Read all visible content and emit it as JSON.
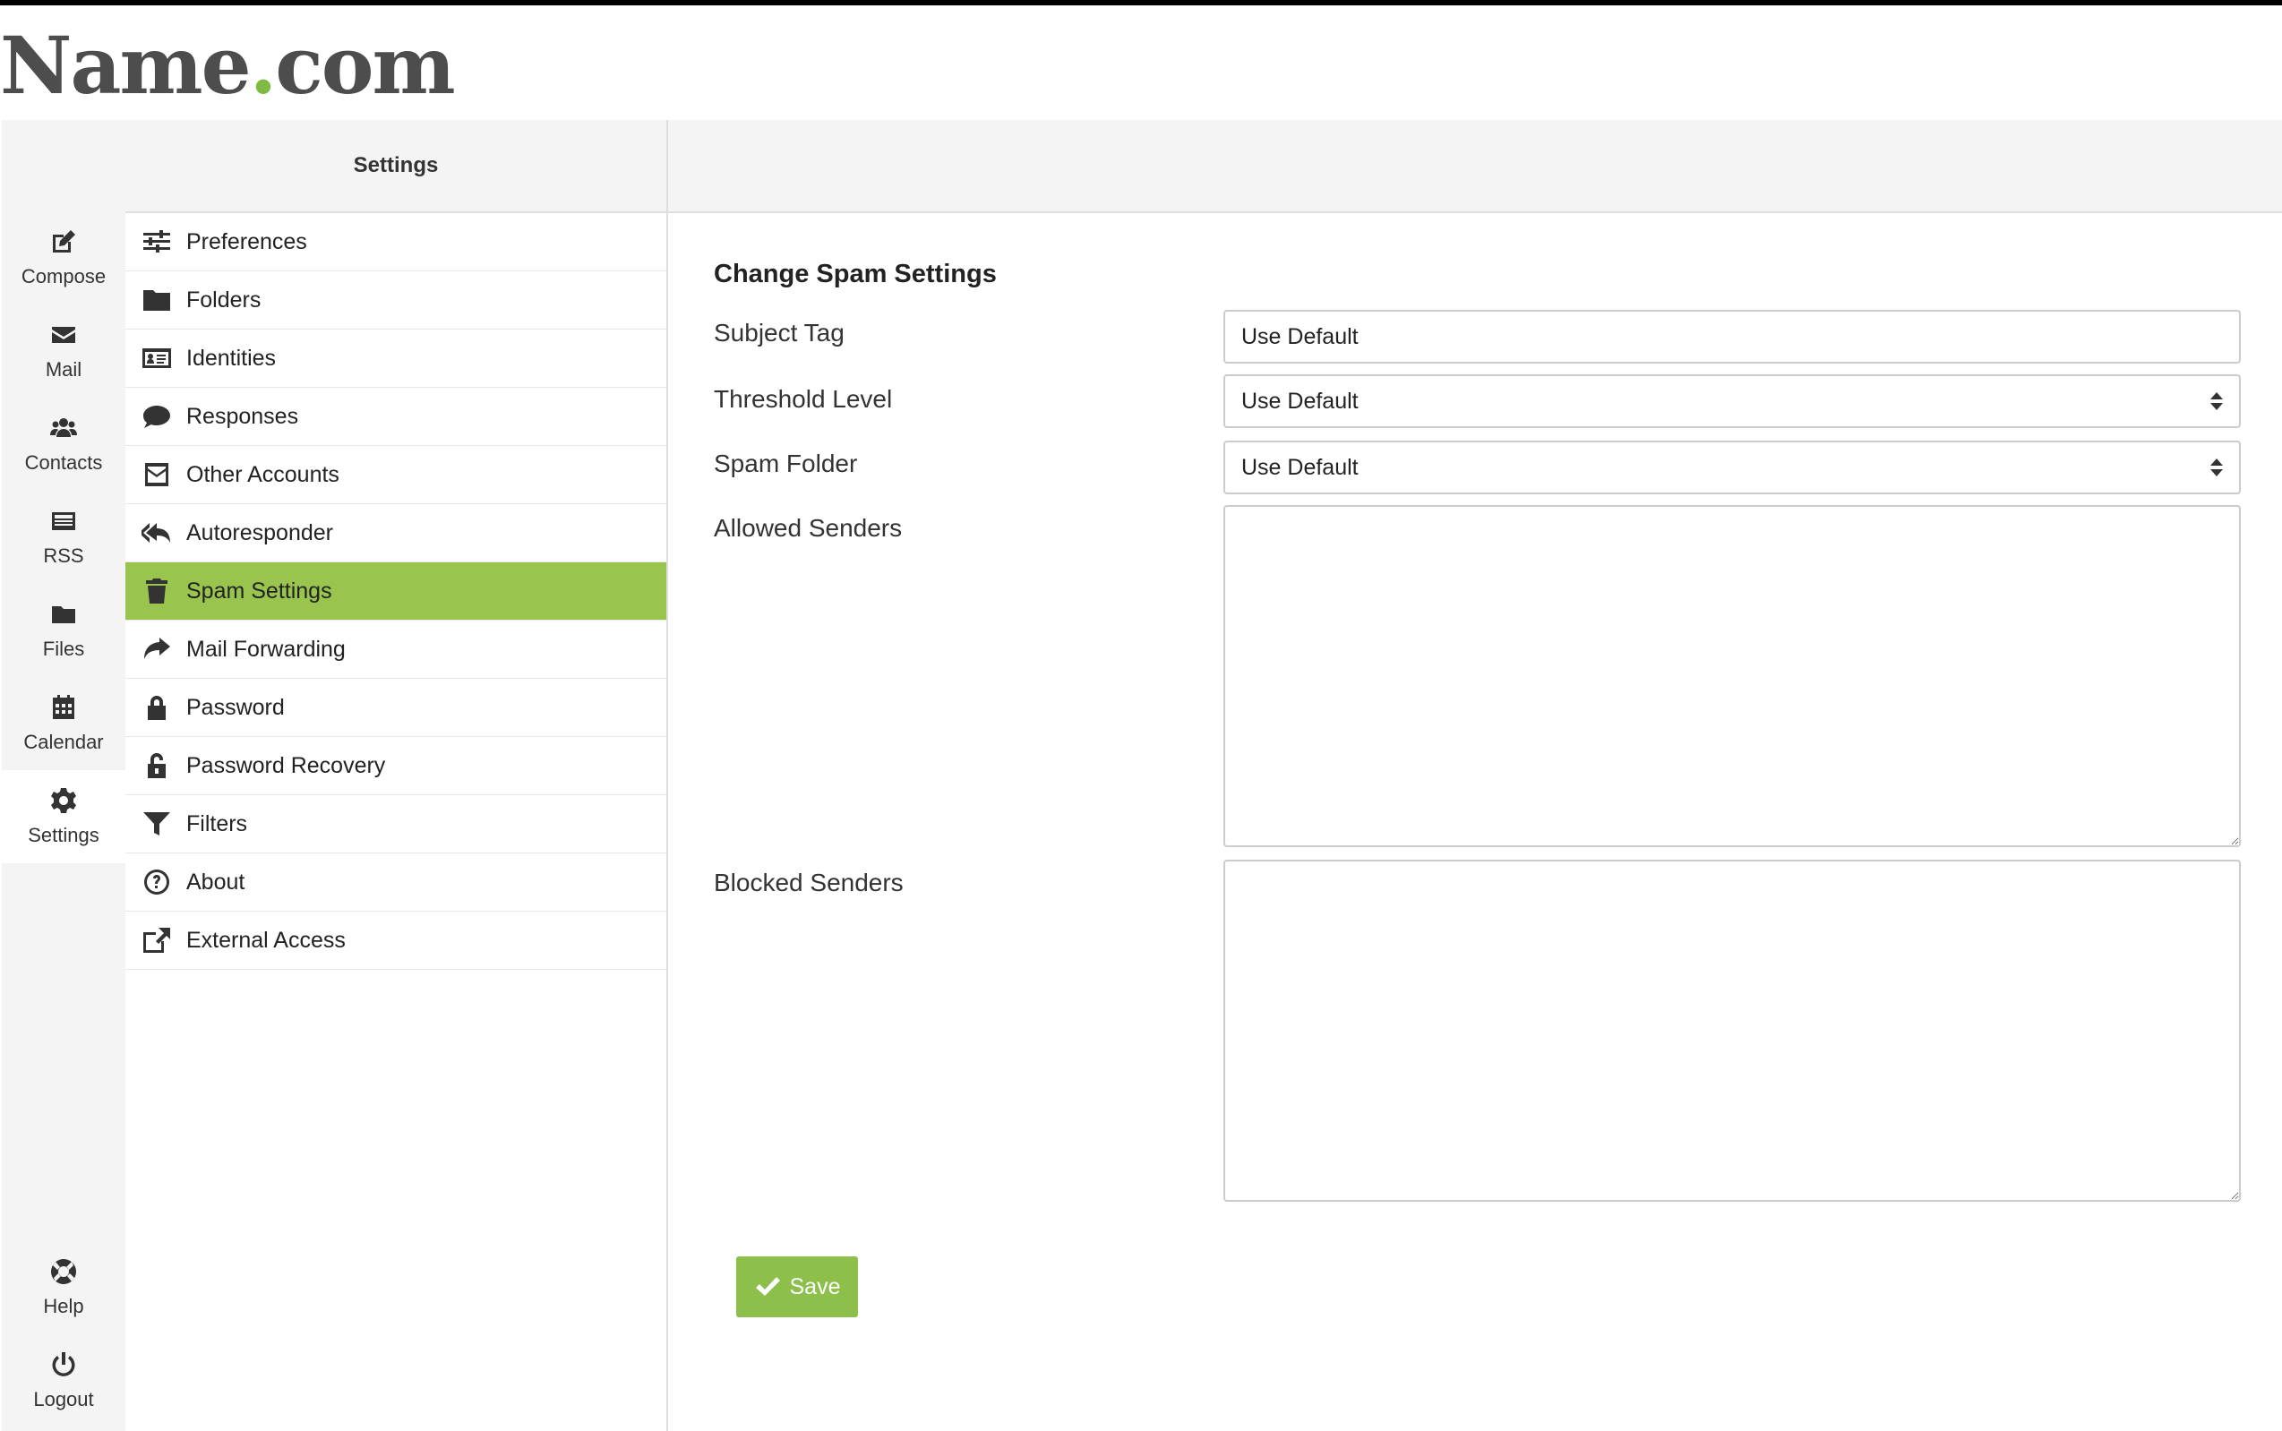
{
  "brand": {
    "name": "Name",
    "dot": ".",
    "tld": "com"
  },
  "iconbar": {
    "items": [
      {
        "label": "Compose",
        "icon": "compose-icon"
      },
      {
        "label": "Mail",
        "icon": "envelope-icon"
      },
      {
        "label": "Contacts",
        "icon": "users-icon"
      },
      {
        "label": "RSS",
        "icon": "news-icon"
      },
      {
        "label": "Files",
        "icon": "folder-icon"
      },
      {
        "label": "Calendar",
        "icon": "calendar-icon"
      },
      {
        "label": "Settings",
        "icon": "gear-icon",
        "active": true
      }
    ],
    "bottom": [
      {
        "label": "Help",
        "icon": "lifebuoy-icon"
      },
      {
        "label": "Logout",
        "icon": "power-icon"
      }
    ]
  },
  "settings": {
    "title": "Settings",
    "menu": [
      {
        "label": "Preferences",
        "icon": "sliders-icon"
      },
      {
        "label": "Folders",
        "icon": "folder-icon"
      },
      {
        "label": "Identities",
        "icon": "id-card-icon"
      },
      {
        "label": "Responses",
        "icon": "speech-bubble-icon"
      },
      {
        "label": "Other Accounts",
        "icon": "envelope-square-icon"
      },
      {
        "label": "Autoresponder",
        "icon": "reply-all-icon"
      },
      {
        "label": "Spam Settings",
        "icon": "trash-icon",
        "active": true
      },
      {
        "label": "Mail Forwarding",
        "icon": "share-icon"
      },
      {
        "label": "Password",
        "icon": "lock-icon"
      },
      {
        "label": "Password Recovery",
        "icon": "unlock-icon"
      },
      {
        "label": "Filters",
        "icon": "filter-icon"
      },
      {
        "label": "About",
        "icon": "question-circle-icon"
      },
      {
        "label": "External Access",
        "icon": "external-link-icon"
      }
    ]
  },
  "form": {
    "title": "Change Spam Settings",
    "subject_tag": {
      "label": "Subject Tag",
      "value": "Use Default"
    },
    "threshold": {
      "label": "Threshold Level",
      "value": "Use Default"
    },
    "spam_folder": {
      "label": "Spam Folder",
      "value": "Use Default"
    },
    "allowed": {
      "label": "Allowed Senders",
      "value": ""
    },
    "blocked": {
      "label": "Blocked Senders",
      "value": ""
    },
    "save_label": "Save"
  },
  "colors": {
    "accent": "#99c54e",
    "button": "#8cc04b",
    "brand_dot": "#7dbb42"
  }
}
